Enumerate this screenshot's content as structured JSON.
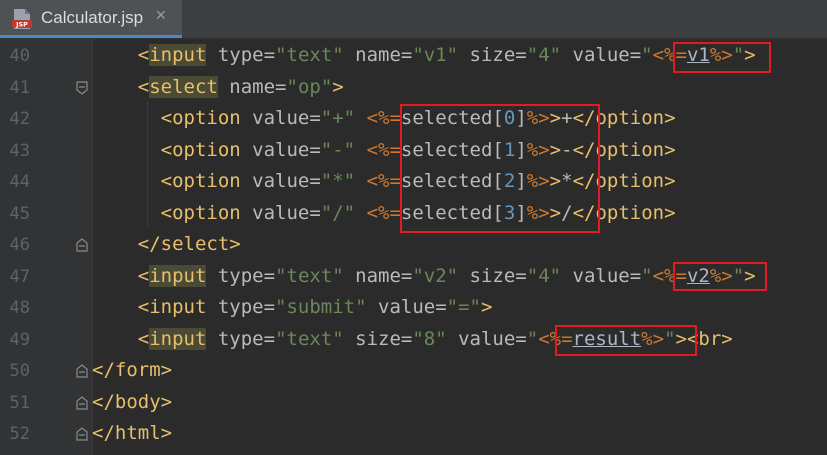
{
  "tab": {
    "title": "Calculator.jsp",
    "close": "✕",
    "icon_text": "JSP"
  },
  "lines": [
    {
      "n": "40",
      "indent": "    ",
      "tokens": [
        {
          "c": "tag",
          "v": "<"
        },
        {
          "c": "tag tag-hl",
          "v": "input"
        },
        {
          "c": "attr",
          "v": " type="
        },
        {
          "c": "str",
          "v": "\"text\""
        },
        {
          "c": "attr",
          "v": " name="
        },
        {
          "c": "str",
          "v": "\"v1\""
        },
        {
          "c": "attr",
          "v": " size="
        },
        {
          "c": "str",
          "v": "\"4\""
        },
        {
          "c": "attr",
          "v": " value="
        },
        {
          "c": "str",
          "v": "\""
        },
        {
          "c": "jsp",
          "v": "<%="
        },
        {
          "c": "var",
          "v": "v1"
        },
        {
          "c": "jsp",
          "v": "%>"
        },
        {
          "c": "str",
          "v": "\""
        },
        {
          "c": "tag",
          "v": ">"
        }
      ]
    },
    {
      "n": "41",
      "indent": "    ",
      "tokens": [
        {
          "c": "tag",
          "v": "<"
        },
        {
          "c": "tag tag-hl",
          "v": "select"
        },
        {
          "c": "attr",
          "v": " name="
        },
        {
          "c": "str",
          "v": "\"op\""
        },
        {
          "c": "tag",
          "v": ">"
        }
      ]
    },
    {
      "n": "42",
      "indent": "      ",
      "tokens": [
        {
          "c": "tag",
          "v": "<option"
        },
        {
          "c": "attr",
          "v": " value="
        },
        {
          "c": "str",
          "v": "\"+\""
        },
        {
          "c": "attr",
          "v": " "
        },
        {
          "c": "jsp",
          "v": "<%="
        },
        {
          "c": "attr",
          "v": "selected["
        },
        {
          "c": "idx",
          "v": "0"
        },
        {
          "c": "attr",
          "v": "]"
        },
        {
          "c": "jsp",
          "v": "%>"
        },
        {
          "c": "tag",
          "v": ">"
        },
        {
          "c": "attr",
          "v": "+"
        },
        {
          "c": "tag",
          "v": "</option>"
        }
      ]
    },
    {
      "n": "43",
      "indent": "      ",
      "tokens": [
        {
          "c": "tag",
          "v": "<option"
        },
        {
          "c": "attr",
          "v": " value="
        },
        {
          "c": "str",
          "v": "\"-\""
        },
        {
          "c": "attr",
          "v": " "
        },
        {
          "c": "jsp",
          "v": "<%="
        },
        {
          "c": "attr",
          "v": "selected["
        },
        {
          "c": "idx",
          "v": "1"
        },
        {
          "c": "attr",
          "v": "]"
        },
        {
          "c": "jsp",
          "v": "%>"
        },
        {
          "c": "tag",
          "v": ">"
        },
        {
          "c": "attr",
          "v": "-"
        },
        {
          "c": "tag",
          "v": "</option>"
        }
      ]
    },
    {
      "n": "44",
      "indent": "      ",
      "tokens": [
        {
          "c": "tag",
          "v": "<option"
        },
        {
          "c": "attr",
          "v": " value="
        },
        {
          "c": "str",
          "v": "\"*\""
        },
        {
          "c": "attr",
          "v": " "
        },
        {
          "c": "jsp",
          "v": "<%="
        },
        {
          "c": "attr",
          "v": "selected["
        },
        {
          "c": "idx",
          "v": "2"
        },
        {
          "c": "attr",
          "v": "]"
        },
        {
          "c": "jsp",
          "v": "%>"
        },
        {
          "c": "tag",
          "v": ">"
        },
        {
          "c": "attr",
          "v": "*"
        },
        {
          "c": "tag",
          "v": "</option>"
        }
      ]
    },
    {
      "n": "45",
      "indent": "      ",
      "tokens": [
        {
          "c": "tag",
          "v": "<option"
        },
        {
          "c": "attr",
          "v": " value="
        },
        {
          "c": "str",
          "v": "\"/\""
        },
        {
          "c": "attr",
          "v": " "
        },
        {
          "c": "jsp",
          "v": "<%="
        },
        {
          "c": "attr",
          "v": "selected["
        },
        {
          "c": "idx",
          "v": "3"
        },
        {
          "c": "attr",
          "v": "]"
        },
        {
          "c": "jsp",
          "v": "%>"
        },
        {
          "c": "tag",
          "v": ">"
        },
        {
          "c": "attr",
          "v": "/"
        },
        {
          "c": "tag",
          "v": "</option>"
        }
      ]
    },
    {
      "n": "46",
      "indent": "    ",
      "tokens": [
        {
          "c": "tag",
          "v": "</select>"
        }
      ]
    },
    {
      "n": "47",
      "indent": "    ",
      "tokens": [
        {
          "c": "tag",
          "v": "<"
        },
        {
          "c": "tag tag-hl",
          "v": "input"
        },
        {
          "c": "attr",
          "v": " type="
        },
        {
          "c": "str",
          "v": "\"text\""
        },
        {
          "c": "attr",
          "v": " name="
        },
        {
          "c": "str",
          "v": "\"v2\""
        },
        {
          "c": "attr",
          "v": " size="
        },
        {
          "c": "str",
          "v": "\"4\""
        },
        {
          "c": "attr",
          "v": " value="
        },
        {
          "c": "str",
          "v": "\""
        },
        {
          "c": "jsp",
          "v": "<%="
        },
        {
          "c": "var",
          "v": "v2"
        },
        {
          "c": "jsp",
          "v": "%>"
        },
        {
          "c": "str",
          "v": "\""
        },
        {
          "c": "tag",
          "v": ">"
        }
      ]
    },
    {
      "n": "48",
      "indent": "    ",
      "tokens": [
        {
          "c": "tag",
          "v": "<input"
        },
        {
          "c": "attr",
          "v": " type="
        },
        {
          "c": "str",
          "v": "\"submit\""
        },
        {
          "c": "attr",
          "v": " value="
        },
        {
          "c": "str",
          "v": "\"=\""
        },
        {
          "c": "tag",
          "v": ">"
        }
      ]
    },
    {
      "n": "49",
      "indent": "    ",
      "tokens": [
        {
          "c": "tag",
          "v": "<"
        },
        {
          "c": "tag tag-hl",
          "v": "input"
        },
        {
          "c": "attr",
          "v": " type="
        },
        {
          "c": "str",
          "v": "\"text\""
        },
        {
          "c": "attr",
          "v": " size="
        },
        {
          "c": "str",
          "v": "\"8\""
        },
        {
          "c": "attr",
          "v": " value="
        },
        {
          "c": "str",
          "v": "\""
        },
        {
          "c": "jsp",
          "v": "<%="
        },
        {
          "c": "var",
          "v": "result"
        },
        {
          "c": "jsp",
          "v": "%>"
        },
        {
          "c": "str",
          "v": "\""
        },
        {
          "c": "tag",
          "v": "><br>"
        }
      ]
    },
    {
      "n": "50",
      "indent": "",
      "tokens": [
        {
          "c": "tag",
          "v": "</form>"
        }
      ]
    },
    {
      "n": "51",
      "indent": "",
      "tokens": [
        {
          "c": "tag",
          "v": "</body>"
        }
      ]
    },
    {
      "n": "52",
      "indent": "",
      "tokens": [
        {
          "c": "tag",
          "v": "</html>"
        }
      ]
    }
  ]
}
